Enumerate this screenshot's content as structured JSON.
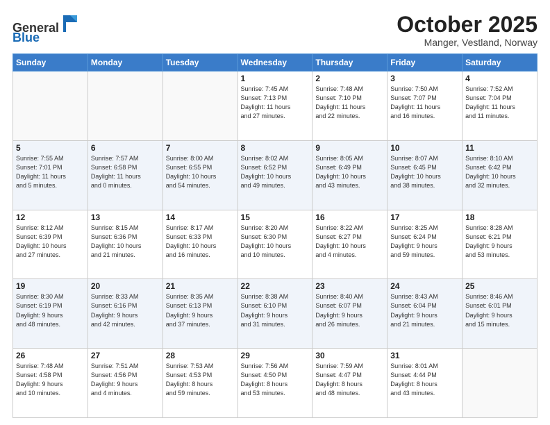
{
  "header": {
    "logo_line1": "General",
    "logo_line2": "Blue",
    "month": "October 2025",
    "location": "Manger, Vestland, Norway"
  },
  "days_of_week": [
    "Sunday",
    "Monday",
    "Tuesday",
    "Wednesday",
    "Thursday",
    "Friday",
    "Saturday"
  ],
  "weeks": [
    [
      {
        "day": "",
        "info": ""
      },
      {
        "day": "",
        "info": ""
      },
      {
        "day": "",
        "info": ""
      },
      {
        "day": "1",
        "info": "Sunrise: 7:45 AM\nSunset: 7:13 PM\nDaylight: 11 hours\nand 27 minutes."
      },
      {
        "day": "2",
        "info": "Sunrise: 7:48 AM\nSunset: 7:10 PM\nDaylight: 11 hours\nand 22 minutes."
      },
      {
        "day": "3",
        "info": "Sunrise: 7:50 AM\nSunset: 7:07 PM\nDaylight: 11 hours\nand 16 minutes."
      },
      {
        "day": "4",
        "info": "Sunrise: 7:52 AM\nSunset: 7:04 PM\nDaylight: 11 hours\nand 11 minutes."
      }
    ],
    [
      {
        "day": "5",
        "info": "Sunrise: 7:55 AM\nSunset: 7:01 PM\nDaylight: 11 hours\nand 5 minutes."
      },
      {
        "day": "6",
        "info": "Sunrise: 7:57 AM\nSunset: 6:58 PM\nDaylight: 11 hours\nand 0 minutes."
      },
      {
        "day": "7",
        "info": "Sunrise: 8:00 AM\nSunset: 6:55 PM\nDaylight: 10 hours\nand 54 minutes."
      },
      {
        "day": "8",
        "info": "Sunrise: 8:02 AM\nSunset: 6:52 PM\nDaylight: 10 hours\nand 49 minutes."
      },
      {
        "day": "9",
        "info": "Sunrise: 8:05 AM\nSunset: 6:49 PM\nDaylight: 10 hours\nand 43 minutes."
      },
      {
        "day": "10",
        "info": "Sunrise: 8:07 AM\nSunset: 6:45 PM\nDaylight: 10 hours\nand 38 minutes."
      },
      {
        "day": "11",
        "info": "Sunrise: 8:10 AM\nSunset: 6:42 PM\nDaylight: 10 hours\nand 32 minutes."
      }
    ],
    [
      {
        "day": "12",
        "info": "Sunrise: 8:12 AM\nSunset: 6:39 PM\nDaylight: 10 hours\nand 27 minutes."
      },
      {
        "day": "13",
        "info": "Sunrise: 8:15 AM\nSunset: 6:36 PM\nDaylight: 10 hours\nand 21 minutes."
      },
      {
        "day": "14",
        "info": "Sunrise: 8:17 AM\nSunset: 6:33 PM\nDaylight: 10 hours\nand 16 minutes."
      },
      {
        "day": "15",
        "info": "Sunrise: 8:20 AM\nSunset: 6:30 PM\nDaylight: 10 hours\nand 10 minutes."
      },
      {
        "day": "16",
        "info": "Sunrise: 8:22 AM\nSunset: 6:27 PM\nDaylight: 10 hours\nand 4 minutes."
      },
      {
        "day": "17",
        "info": "Sunrise: 8:25 AM\nSunset: 6:24 PM\nDaylight: 9 hours\nand 59 minutes."
      },
      {
        "day": "18",
        "info": "Sunrise: 8:28 AM\nSunset: 6:21 PM\nDaylight: 9 hours\nand 53 minutes."
      }
    ],
    [
      {
        "day": "19",
        "info": "Sunrise: 8:30 AM\nSunset: 6:19 PM\nDaylight: 9 hours\nand 48 minutes."
      },
      {
        "day": "20",
        "info": "Sunrise: 8:33 AM\nSunset: 6:16 PM\nDaylight: 9 hours\nand 42 minutes."
      },
      {
        "day": "21",
        "info": "Sunrise: 8:35 AM\nSunset: 6:13 PM\nDaylight: 9 hours\nand 37 minutes."
      },
      {
        "day": "22",
        "info": "Sunrise: 8:38 AM\nSunset: 6:10 PM\nDaylight: 9 hours\nand 31 minutes."
      },
      {
        "day": "23",
        "info": "Sunrise: 8:40 AM\nSunset: 6:07 PM\nDaylight: 9 hours\nand 26 minutes."
      },
      {
        "day": "24",
        "info": "Sunrise: 8:43 AM\nSunset: 6:04 PM\nDaylight: 9 hours\nand 21 minutes."
      },
      {
        "day": "25",
        "info": "Sunrise: 8:46 AM\nSunset: 6:01 PM\nDaylight: 9 hours\nand 15 minutes."
      }
    ],
    [
      {
        "day": "26",
        "info": "Sunrise: 7:48 AM\nSunset: 4:58 PM\nDaylight: 9 hours\nand 10 minutes."
      },
      {
        "day": "27",
        "info": "Sunrise: 7:51 AM\nSunset: 4:56 PM\nDaylight: 9 hours\nand 4 minutes."
      },
      {
        "day": "28",
        "info": "Sunrise: 7:53 AM\nSunset: 4:53 PM\nDaylight: 8 hours\nand 59 minutes."
      },
      {
        "day": "29",
        "info": "Sunrise: 7:56 AM\nSunset: 4:50 PM\nDaylight: 8 hours\nand 53 minutes."
      },
      {
        "day": "30",
        "info": "Sunrise: 7:59 AM\nSunset: 4:47 PM\nDaylight: 8 hours\nand 48 minutes."
      },
      {
        "day": "31",
        "info": "Sunrise: 8:01 AM\nSunset: 4:44 PM\nDaylight: 8 hours\nand 43 minutes."
      },
      {
        "day": "",
        "info": ""
      }
    ]
  ]
}
